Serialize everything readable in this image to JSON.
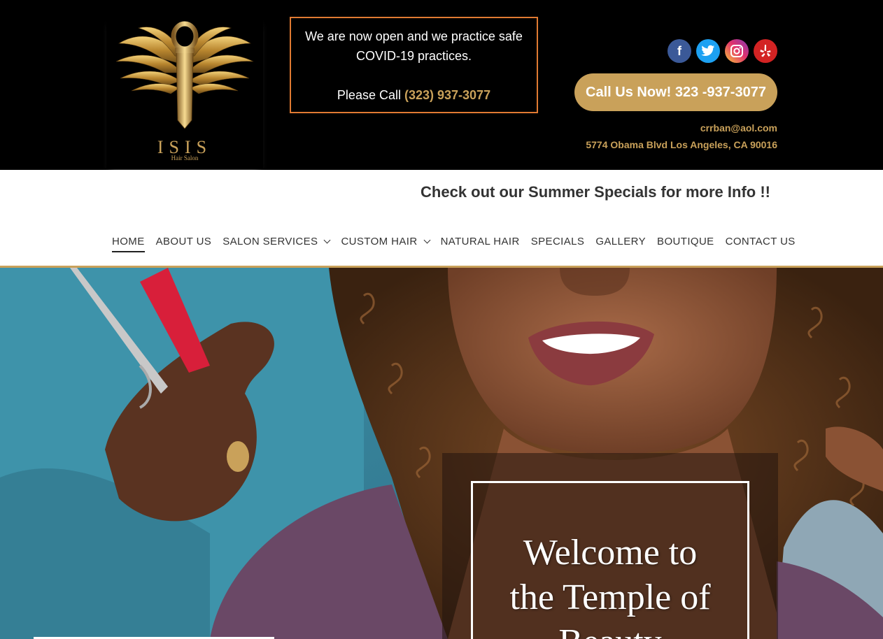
{
  "brand": {
    "name": "ISIS",
    "tagline": "Hair Salon"
  },
  "covid_notice": {
    "line1": "We are now open and we practice safe",
    "line2": "COVID-19 practices.",
    "call_prefix": "Please Call",
    "phone": "(323) 937-3077",
    "border_color": "#e07a32"
  },
  "social": [
    {
      "name": "facebook",
      "icon": "facebook-icon",
      "glyph": "f"
    },
    {
      "name": "twitter",
      "icon": "twitter-icon",
      "glyph": ""
    },
    {
      "name": "instagram",
      "icon": "instagram-icon",
      "glyph": ""
    },
    {
      "name": "yelp",
      "icon": "yelp-icon",
      "glyph": ""
    }
  ],
  "contact": {
    "call_button": "Call Us Now! 323 -937-3077",
    "email": "crrban@aol.com",
    "address": "5774 Obama Blvd Los Angeles, CA 90016"
  },
  "promo": "Check out our Summer Specials for more Info !!",
  "nav": {
    "items": [
      {
        "label": "HOME",
        "active": true,
        "dropdown": false
      },
      {
        "label": "ABOUT US",
        "active": false,
        "dropdown": false
      },
      {
        "label": "SALON SERVICES",
        "active": false,
        "dropdown": true
      },
      {
        "label": "CUSTOM HAIR",
        "active": false,
        "dropdown": true
      },
      {
        "label": "NATURAL HAIR",
        "active": false,
        "dropdown": false
      },
      {
        "label": "SPECIALS",
        "active": false,
        "dropdown": false
      },
      {
        "label": "GALLERY",
        "active": false,
        "dropdown": false
      },
      {
        "label": "BOUTIQUE",
        "active": false,
        "dropdown": false
      },
      {
        "label": "CONTACT US",
        "active": false,
        "dropdown": false
      }
    ]
  },
  "hero": {
    "line1": "Welcome to",
    "line2": "the Temple of",
    "line3": "Beauty"
  },
  "colors": {
    "gold": "#c9a15a",
    "header_bg": "#000000",
    "nav_text": "#333333"
  }
}
